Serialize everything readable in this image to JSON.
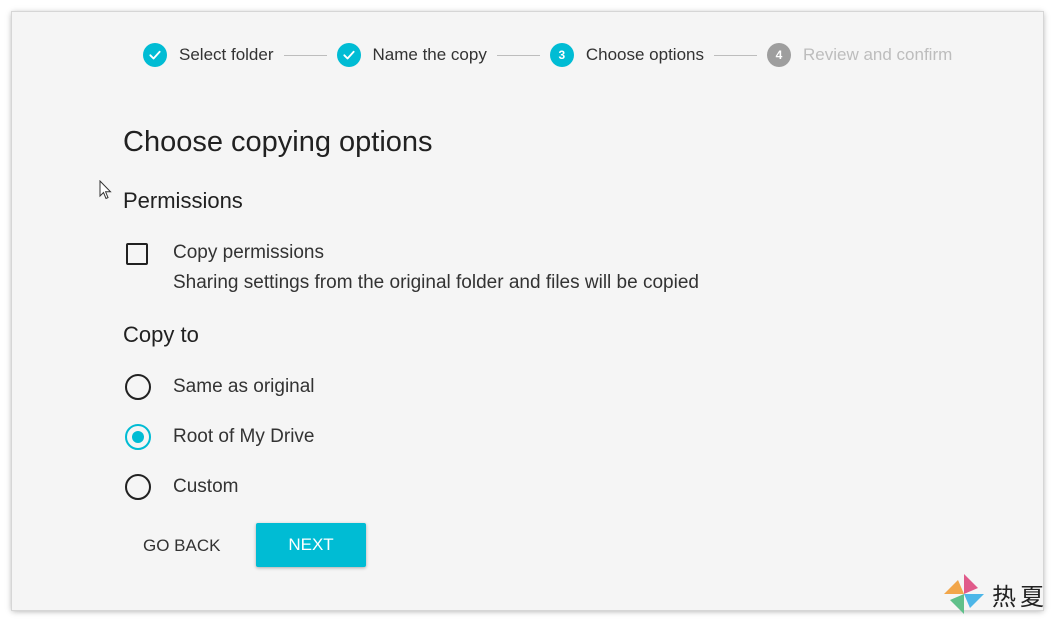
{
  "stepper": {
    "steps": [
      {
        "label": "Select folder",
        "state": "done",
        "number": "1"
      },
      {
        "label": "Name the copy",
        "state": "done",
        "number": "2"
      },
      {
        "label": "Choose options",
        "state": "active",
        "number": "3"
      },
      {
        "label": "Review and confirm",
        "state": "pending",
        "number": "4"
      }
    ]
  },
  "main": {
    "heading": "Choose copying options",
    "permissions": {
      "title": "Permissions",
      "checkbox_label": "Copy permissions",
      "checkbox_description": "Sharing settings from the original folder and files will be copied",
      "checked": false
    },
    "copy_to": {
      "title": "Copy to",
      "options": [
        {
          "label": "Same as original",
          "selected": false
        },
        {
          "label": "Root of My Drive",
          "selected": true
        },
        {
          "label": "Custom",
          "selected": false
        }
      ]
    }
  },
  "actions": {
    "back_label": "GO BACK",
    "next_label": "NEXT"
  },
  "watermark": {
    "text": "热夏"
  },
  "colors": {
    "accent": "#00bcd4",
    "pending": "#9e9e9e",
    "background": "#f5f5f5"
  }
}
